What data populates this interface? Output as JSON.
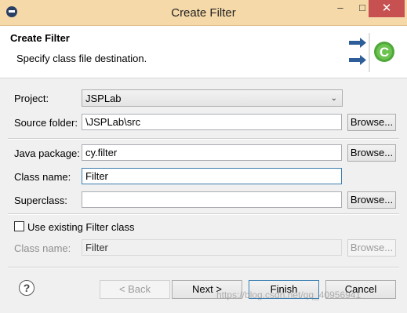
{
  "window": {
    "title": "Create Filter"
  },
  "header": {
    "title": "Create Filter",
    "description": "Specify class file destination."
  },
  "form": {
    "project": {
      "label": "Project:",
      "value": "JSPLab"
    },
    "source_folder": {
      "label": "Source folder:",
      "value": "\\JSPLab\\src",
      "browse": "Browse..."
    },
    "java_package": {
      "label": "Java package:",
      "value": "cy.filter",
      "browse": "Browse..."
    },
    "class_name": {
      "label": "Class name:",
      "value": "Filter"
    },
    "superclass": {
      "label": "Superclass:",
      "value": "",
      "browse": "Browse..."
    },
    "use_existing": {
      "label": "Use existing Filter class",
      "checked": false
    },
    "existing_class_name": {
      "label": "Class name:",
      "value": "Filter",
      "browse": "Browse..."
    }
  },
  "buttons": {
    "back": "< Back",
    "next": "Next >",
    "finish": "Finish",
    "cancel": "Cancel"
  },
  "watermark": "https://blog.csdn.net/qq_40956941",
  "icons": [
    "window-menu-icon",
    "minimize-icon",
    "maximize-icon",
    "close-icon",
    "class-wizard-icon",
    "dropdown-arrow-icon",
    "help-icon"
  ]
}
